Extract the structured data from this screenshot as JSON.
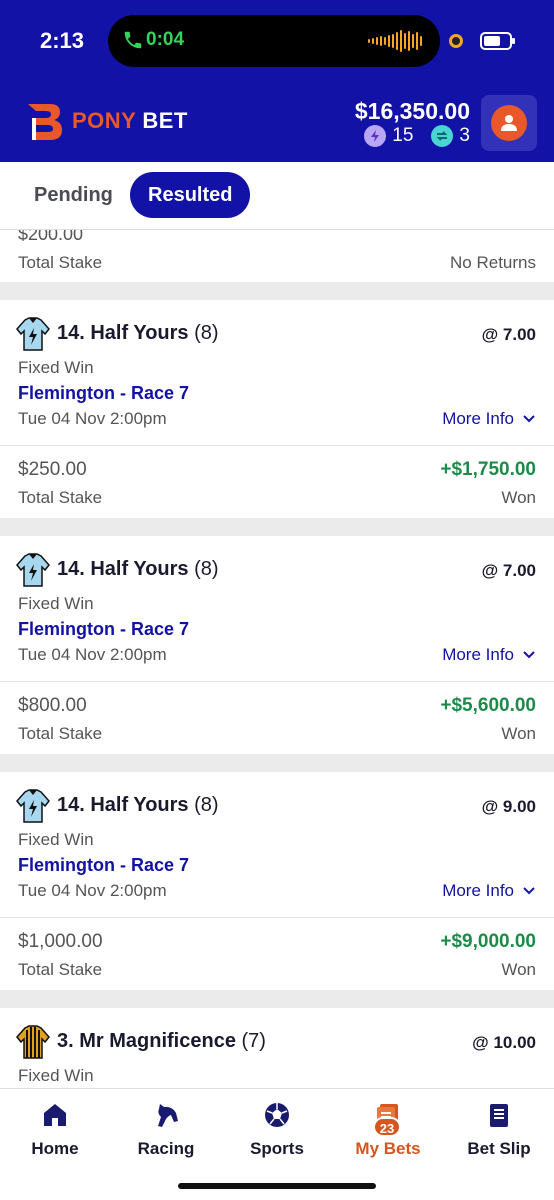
{
  "status_bar": {
    "time": "2:13",
    "call_timer": "0:04"
  },
  "header": {
    "logo_pony": "PONY",
    "logo_bet": "BET",
    "balance": "$16,350.00",
    "bolt_tokens": "15",
    "swap_tokens": "3",
    "colors": {
      "header_bg": "#1212a6",
      "accent": "#e8582a"
    }
  },
  "tabs": [
    {
      "label": "Pending",
      "active": false
    },
    {
      "label": "Resulted",
      "active": true
    }
  ],
  "partial_card": {
    "stake_partial": "$200.00",
    "stake_label": "Total Stake",
    "result": "No Returns"
  },
  "bets": [
    {
      "runner_name": "14. Half Yours",
      "barrier": "(8)",
      "odds": "@ 7.00",
      "bet_type": "Fixed Win",
      "race": "Flemington - Race 7",
      "race_time": "Tue 04 Nov 2:00pm",
      "more_info": "More Info",
      "stake": "$250.00",
      "stake_label": "Total Stake",
      "return": "+$1,750.00",
      "result": "Won"
    },
    {
      "runner_name": "14. Half Yours",
      "barrier": "(8)",
      "odds": "@ 7.00",
      "bet_type": "Fixed Win",
      "race": "Flemington - Race 7",
      "race_time": "Tue 04 Nov 2:00pm",
      "more_info": "More Info",
      "stake": "$800.00",
      "stake_label": "Total Stake",
      "return": "+$5,600.00",
      "result": "Won"
    },
    {
      "runner_name": "14. Half Yours",
      "barrier": "(8)",
      "odds": "@ 9.00",
      "bet_type": "Fixed Win",
      "race": "Flemington - Race 7",
      "race_time": "Tue 04 Nov 2:00pm",
      "more_info": "More Info",
      "stake": "$1,000.00",
      "stake_label": "Total Stake",
      "return": "+$9,000.00",
      "result": "Won"
    },
    {
      "runner_name": "3. Mr Magnificence",
      "barrier": "(7)",
      "odds": "@ 10.00",
      "bet_type": "Fixed Win"
    }
  ],
  "bottom_nav": [
    {
      "label": "Home",
      "icon": "home-icon"
    },
    {
      "label": "Racing",
      "icon": "horse-icon"
    },
    {
      "label": "Sports",
      "icon": "ball-icon"
    },
    {
      "label": "My Bets",
      "icon": "my-bets-icon",
      "badge": "23",
      "active": true
    },
    {
      "label": "Bet Slip",
      "icon": "bet-slip-icon"
    }
  ]
}
